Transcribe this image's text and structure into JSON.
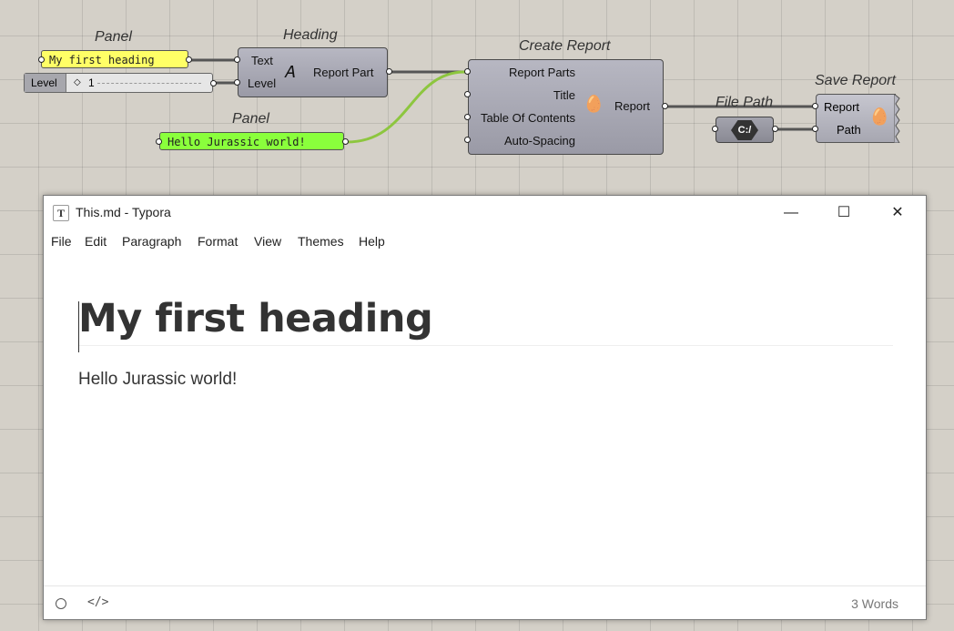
{
  "grasshopper": {
    "panel1": {
      "title": "Panel",
      "text": "My first heading"
    },
    "level_slider": {
      "label": "Level",
      "value": "1"
    },
    "heading": {
      "title": "Heading",
      "inputs": [
        "Text",
        "Level"
      ],
      "output": "Report Part"
    },
    "panel2": {
      "title": "Panel",
      "text": "Hello Jurassic world!"
    },
    "create_report": {
      "title": "Create Report",
      "inputs": [
        "Report Parts",
        "Title",
        "Table Of Contents",
        "Auto-Spacing"
      ],
      "output": "Report"
    },
    "file_path": {
      "title": "File Path",
      "icon_text": "C:/"
    },
    "save_report": {
      "title": "Save Report",
      "inputs": [
        "Report",
        "Path"
      ]
    },
    "colors": {
      "yellow_panel": "#ffff66",
      "green_panel": "#8aff3c",
      "green_wire": "#8dc63f"
    }
  },
  "window": {
    "title": "This.md - Typora",
    "app_icon": "T",
    "buttons": {
      "minimize": "—",
      "maximize": "☐",
      "close": "✕"
    },
    "menu": [
      "File",
      "Edit",
      "Paragraph",
      "Format",
      "View",
      "Themes",
      "Help"
    ],
    "document": {
      "heading": "My first heading",
      "paragraph": "Hello Jurassic world!"
    },
    "status": {
      "code_toggle": "</>",
      "word_count": "3 Words"
    }
  }
}
